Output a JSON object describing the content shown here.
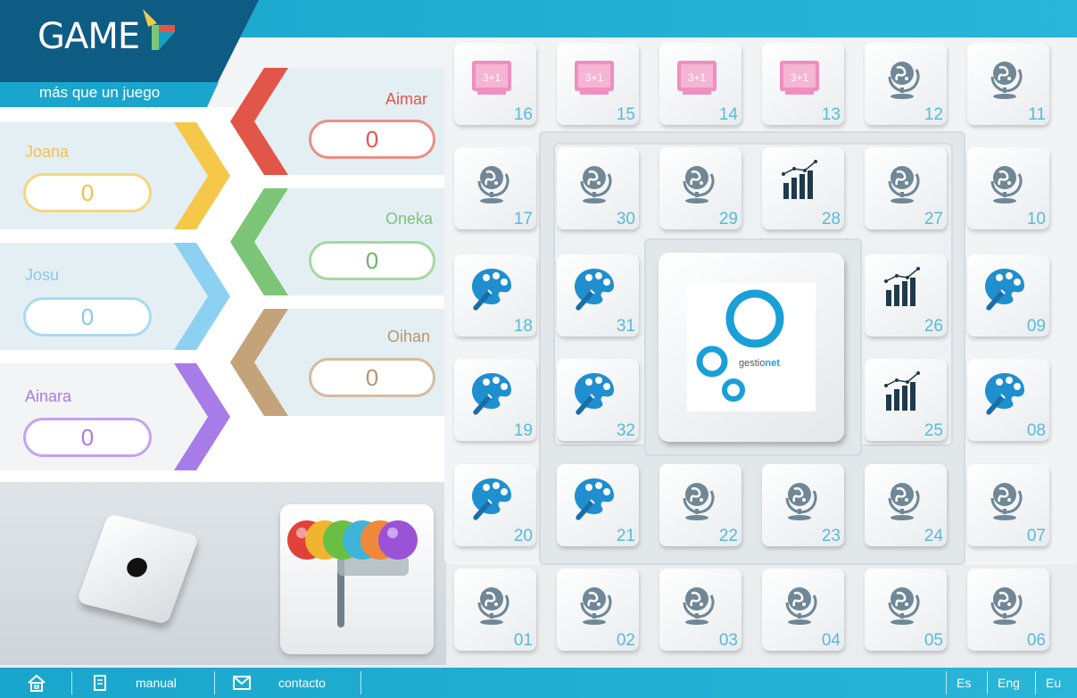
{
  "logo": {
    "title": "GAME",
    "subtitle": "más que un juego"
  },
  "players_left": [
    {
      "name": "Joana",
      "score": "0",
      "color": "#f5c84a"
    },
    {
      "name": "Josu",
      "score": "0",
      "color": "#8cd0f2"
    },
    {
      "name": "Ainara",
      "score": "0",
      "color": "#a77ce8"
    }
  ],
  "players_right": [
    {
      "name": "Aimar",
      "score": "0",
      "color": "#e2564a"
    },
    {
      "name": "Oneka",
      "score": "0",
      "color": "#7cc576"
    },
    {
      "name": "Oihan",
      "score": "0",
      "color": "#c4a37a"
    }
  ],
  "dice": {
    "value": 1
  },
  "center": {
    "brand_prefix": "gestio",
    "brand_suffix": "net"
  },
  "tiles": [
    {
      "n": "16",
      "icon": "math"
    },
    {
      "n": "15",
      "icon": "math"
    },
    {
      "n": "14",
      "icon": "math"
    },
    {
      "n": "13",
      "icon": "math"
    },
    {
      "n": "12",
      "icon": "globe"
    },
    {
      "n": "11",
      "icon": "globe"
    },
    {
      "n": "17",
      "icon": "globe"
    },
    {
      "n": "30",
      "icon": "globe"
    },
    {
      "n": "29",
      "icon": "globe"
    },
    {
      "n": "28",
      "icon": "chart"
    },
    {
      "n": "27",
      "icon": "globe"
    },
    {
      "n": "10",
      "icon": "globe"
    },
    {
      "n": "18",
      "icon": "palette"
    },
    {
      "n": "31",
      "icon": "palette"
    },
    {
      "n": "26",
      "icon": "chart"
    },
    {
      "n": "09",
      "icon": "palette"
    },
    {
      "n": "19",
      "icon": "palette"
    },
    {
      "n": "32",
      "icon": "palette"
    },
    {
      "n": "25",
      "icon": "chart"
    },
    {
      "n": "08",
      "icon": "palette"
    },
    {
      "n": "20",
      "icon": "palette"
    },
    {
      "n": "21",
      "icon": "palette"
    },
    {
      "n": "22",
      "icon": "globe"
    },
    {
      "n": "23",
      "icon": "globe"
    },
    {
      "n": "24",
      "icon": "globe"
    },
    {
      "n": "07",
      "icon": "globe"
    },
    {
      "n": "01",
      "icon": "globe"
    },
    {
      "n": "02",
      "icon": "globe"
    },
    {
      "n": "03",
      "icon": "globe"
    },
    {
      "n": "04",
      "icon": "globe"
    },
    {
      "n": "05",
      "icon": "globe"
    },
    {
      "n": "06",
      "icon": "globe"
    }
  ],
  "bottom": {
    "manual": "manual",
    "contacto": "contacto",
    "lang_es": "Es",
    "lang_eng": "Eng",
    "lang_eu": "Eu"
  },
  "colors": {
    "accent": "#1aa6cc",
    "dark": "#0e5c84",
    "icon_blue": "#1f8fcf",
    "math_pink": "#ee8fbf"
  }
}
